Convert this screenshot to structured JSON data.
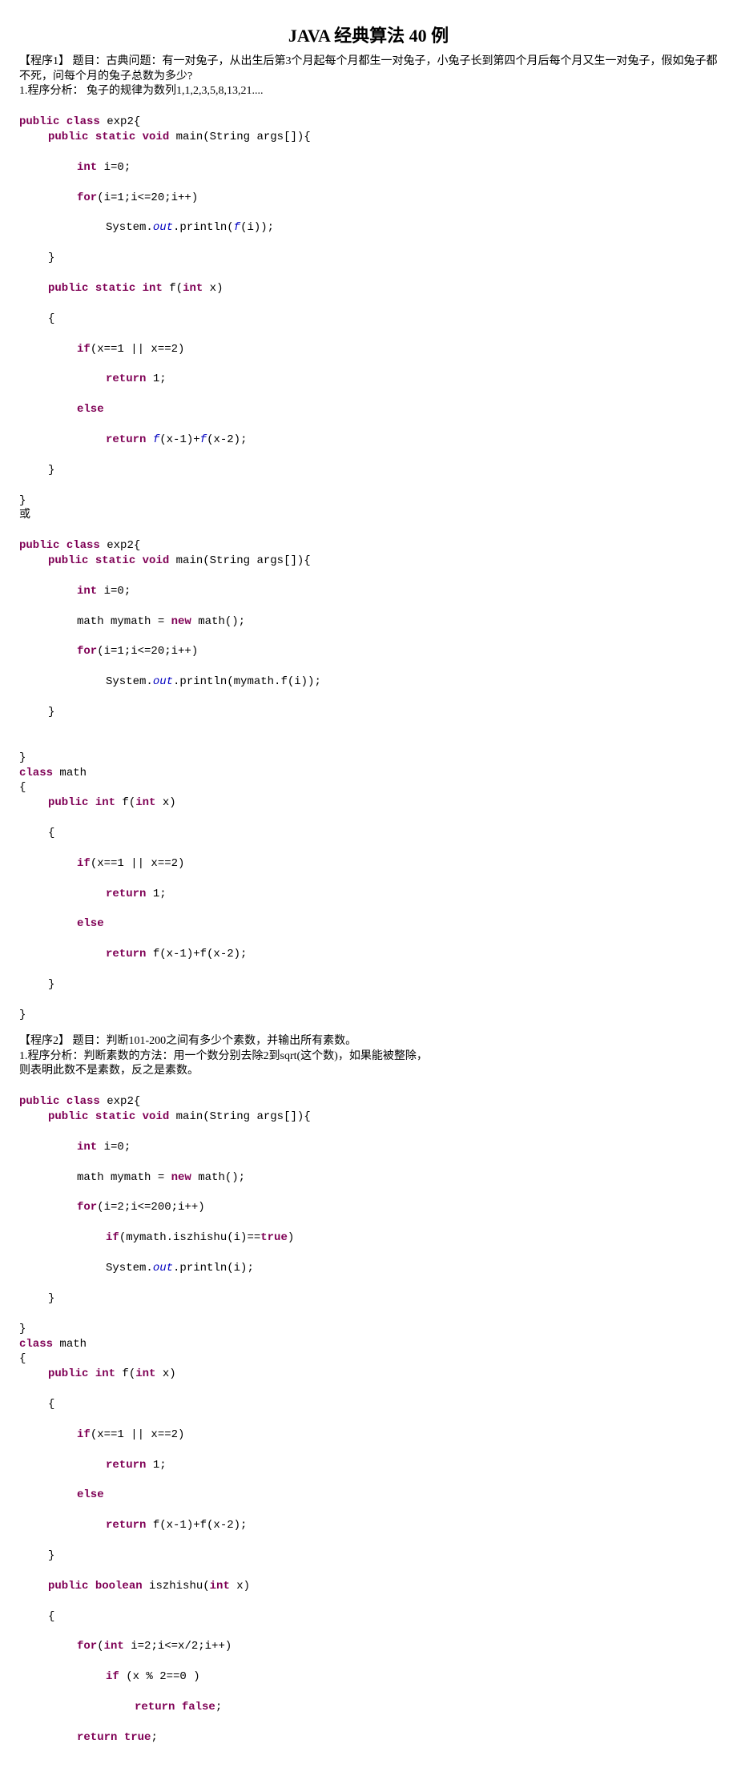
{
  "title": "JAVA 经典算法 40 例",
  "p1": {
    "hdr": "【程序1】   题目：古典问题：有一对兔子，从出生后第3个月起每个月都生一对兔子，小兔子长到第四个月后每个月又生一对兔子，假如兔子都不死，问每个月的兔子总数为多少?",
    "ana": "1.程序分析：      兔子的规律为数列1,1,2,3,5,8,13,21....",
    "c": {
      "l1a": "public",
      "l1b": " class",
      "l1c": " exp2{",
      "l2a": "public",
      "l2b": " static",
      "l2c": " void",
      "l2d": " main(String args[]){",
      "l3a": "int",
      "l3b": " i=0;",
      "l4a": "for",
      "l4b": "(i=1;i<=20;i++)",
      "l5a": "System.",
      "l5b": "out",
      "l5c": ".println(",
      "l5d": "f",
      "l5e": "(i));",
      "l6": "}",
      "l7a": "public",
      "l7b": " static",
      "l7c": " int",
      "l7d": " f(",
      "l7e": "int",
      "l7f": " x)",
      "l8": "{",
      "l9a": "if",
      "l9b": "(x==1 || x==2)",
      "l10a": "return",
      "l10b": " 1;",
      "l11": "else",
      "l12a": "return",
      "l12b": " ",
      "l12c": "f",
      "l12d": "(x-1)+",
      "l12e": "f",
      "l12f": "(x-2);",
      "l13": "}",
      "l14": "}"
    },
    "or": "或",
    "d": {
      "l1a": "public",
      "l1b": " class",
      "l1c": " exp2{",
      "l2a": "public",
      "l2b": " static",
      "l2c": " void",
      "l2d": " main(String args[]){",
      "l3a": "int",
      "l3b": " i=0;",
      "l4a": "math mymath = ",
      "l4b": "new",
      "l4c": " math();",
      "l5a": "for",
      "l5b": "(i=1;i<=20;i++)",
      "l6a": "System.",
      "l6b": "out",
      "l6c": ".println(mymath.f(i));",
      "l7": "}",
      "l8": "",
      "l9": "}",
      "l10a": "class",
      "l10b": " math",
      "l11": "{",
      "l12a": "public",
      "l12b": " int",
      "l12c": " f(",
      "l12d": "int",
      "l12e": " x)",
      "l13": "{",
      "l14a": "if",
      "l14b": "(x==1 || x==2)",
      "l15a": "return",
      "l15b": " 1;",
      "l16": "else",
      "l17a": "return",
      "l17b": " f(x-1)+f(x-2);",
      "l18": "}",
      "l19": "}"
    }
  },
  "p2": {
    "hdr": "【程序2】   题目：判断101-200之间有多少个素数，并输出所有素数。",
    "ana1": "1.程序分析：判断素数的方法：用一个数分别去除2到sqrt(这个数)，如果能被整除，",
    "ana2": "则表明此数不是素数，反之是素数。",
    "c": {
      "l1a": "public",
      "l1b": " class",
      "l1c": " exp2{",
      "l2a": "public",
      "l2b": " static",
      "l2c": " void",
      "l2d": " main(String args[]){",
      "l3a": "int",
      "l3b": " i=0;",
      "l4a": "math mymath = ",
      "l4b": "new",
      "l4c": " math();",
      "l5a": "for",
      "l5b": "(i=2;i<=200;i++)",
      "l6a": "if",
      "l6b": "(mymath.iszhishu(i)==",
      "l6c": "true",
      "l6d": ")",
      "l7a": "System.",
      "l7b": "out",
      "l7c": ".println(i);",
      "l8": "}",
      "l9": "}",
      "l10a": "class",
      "l10b": " math",
      "l11": "{",
      "l12a": "public",
      "l12b": " int",
      "l12c": " f(",
      "l12d": "int",
      "l12e": " x)",
      "l13": "{",
      "l14a": "if",
      "l14b": "(x==1 || x==2)",
      "l15a": "return",
      "l15b": " 1;",
      "l16": "else",
      "l17a": "return",
      "l17b": " f(x-1)+f(x-2);",
      "l18": "}",
      "l19a": "public",
      "l19b": " boolean",
      "l19c": " iszhishu(",
      "l19d": "int",
      "l19e": " x)",
      "l20": "{",
      "l21a": "for",
      "l21b": "(",
      "l21c": "int",
      "l21d": " i=2;i<=x/2;i++)",
      "l22a": "if",
      "l22b": " (x % 2==0 )",
      "l23a": "return",
      "l23b": " false",
      "l23c": ";",
      "l24a": "return",
      "l24b": " true",
      "l24c": ";"
    }
  }
}
